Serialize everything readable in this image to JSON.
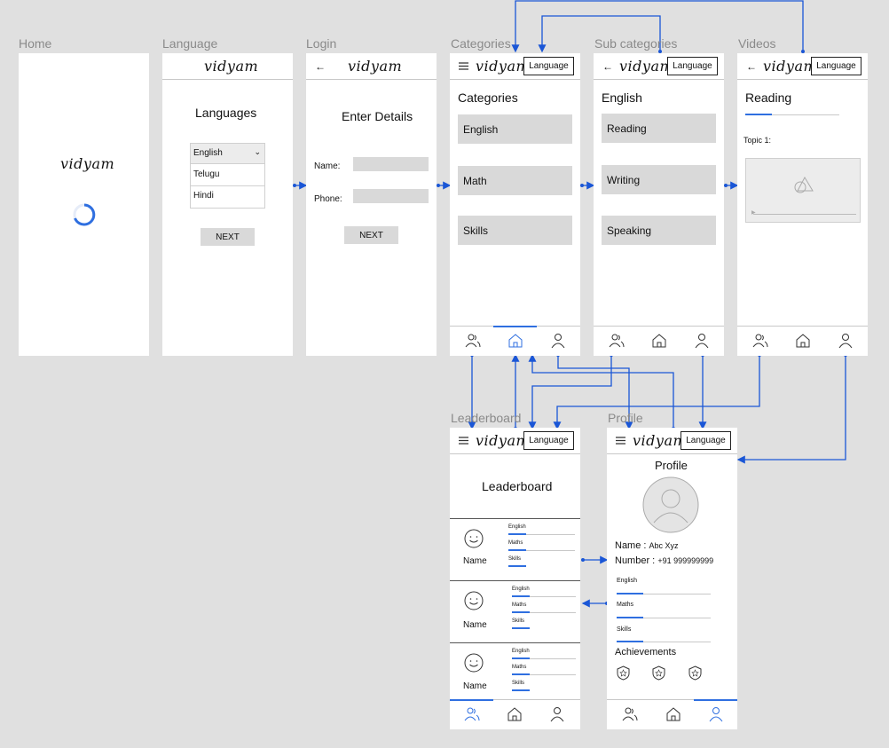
{
  "logo_text": "vidyam",
  "language_button": "Language",
  "frames": {
    "home": {
      "label": "Home"
    },
    "language": {
      "label": "Language",
      "heading": "Languages",
      "options": [
        "English",
        "Telugu",
        "Hindi"
      ],
      "next": "NEXT"
    },
    "login": {
      "label": "Login",
      "heading": "Enter Details",
      "name_label": "Name:",
      "phone_label": "Phone:",
      "next": "NEXT"
    },
    "categories": {
      "label": "Categories",
      "heading": "Categories",
      "items": [
        "English",
        "Math",
        "Skills"
      ]
    },
    "subcategories": {
      "label": "Sub categories",
      "heading": "English",
      "items": [
        "Reading",
        "Writing",
        "Speaking"
      ]
    },
    "videos": {
      "label": "Videos",
      "heading": "Reading",
      "topic": "Topic 1:"
    },
    "leaderboard": {
      "label": "Leaderboard",
      "heading": "Leaderboard",
      "rows": [
        {
          "name": "Name",
          "subjects": [
            "English",
            "Maths",
            "Skills"
          ]
        },
        {
          "name": "Name",
          "subjects": [
            "English",
            "Maths",
            "Skills"
          ]
        },
        {
          "name": "Name",
          "subjects": [
            "English",
            "Maths",
            "Skills"
          ]
        }
      ]
    },
    "profile": {
      "label": "Profile",
      "heading": "Profile",
      "name_label": "Name :",
      "name_value": "Abc Xyz",
      "number_label": "Number :",
      "number_value": "+91 999999999",
      "subjects": [
        "English",
        "Maths",
        "Skills"
      ],
      "achievements": "Achievements"
    }
  },
  "colors": {
    "accent": "#2f6fe0",
    "connector": "#1a56d6",
    "placeholder": "#d9d9d9",
    "canvas": "#e0e0e0"
  },
  "icons": [
    "menu-icon",
    "back-icon",
    "users-icon",
    "home-icon",
    "user-icon",
    "spinner-icon",
    "avatar-icon",
    "smiley-icon",
    "badge-icon",
    "video-placeholder-icon",
    "chevron-down-icon"
  ]
}
